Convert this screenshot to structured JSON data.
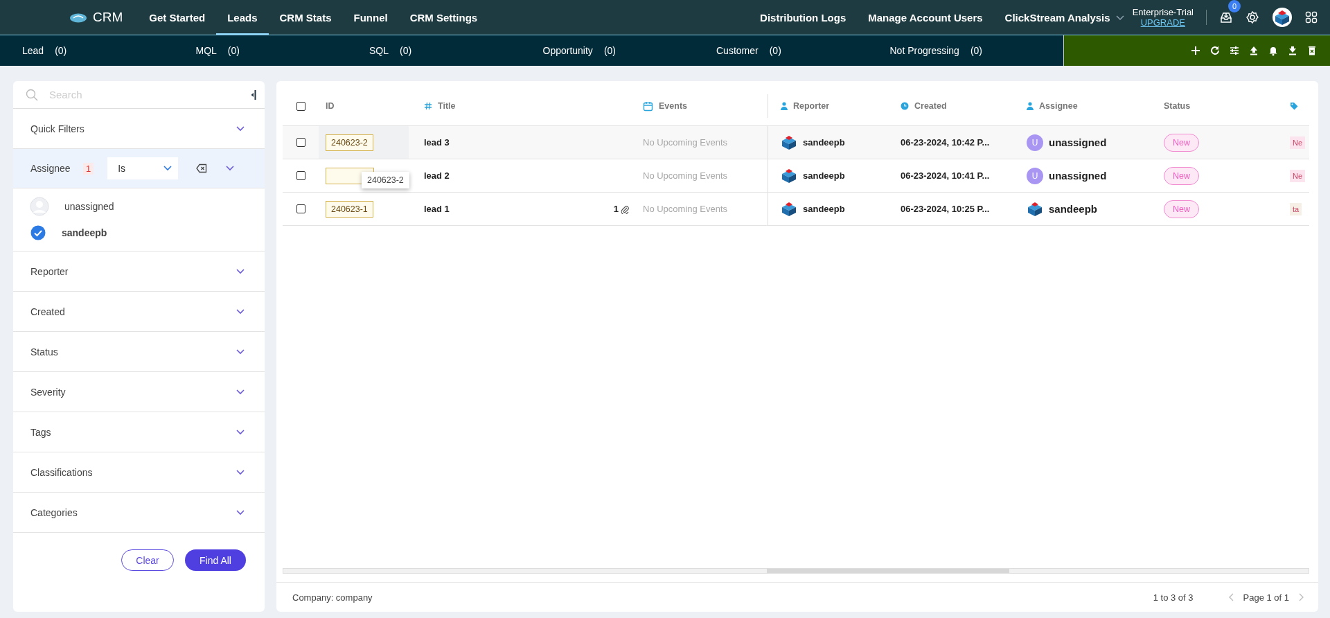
{
  "top_nav": {
    "logo": "CRM",
    "tabs": [
      {
        "label": "Get Started",
        "selected": false
      },
      {
        "label": "Leads",
        "selected": true
      },
      {
        "label": "CRM Stats",
        "selected": false
      },
      {
        "label": "Funnel",
        "selected": false
      },
      {
        "label": "CRM Settings",
        "selected": false
      }
    ],
    "links": [
      "Distribution Logs",
      "Manage Account Users"
    ],
    "project": "ClickStream Analysis",
    "plan": "Enterprise-Trial",
    "upgrade": "UPGRADE",
    "inbox_count": "0"
  },
  "stage_bar": [
    {
      "label": "Lead",
      "count": "(0)"
    },
    {
      "label": "MQL",
      "count": "(0)"
    },
    {
      "label": "SQL",
      "count": "(0)"
    },
    {
      "label": "Opportunity",
      "count": "(0)"
    },
    {
      "label": "Customer",
      "count": "(0)"
    },
    {
      "label": "Not Progressing",
      "count": "(0)"
    }
  ],
  "filters": {
    "search": {
      "placeholder": "Search"
    },
    "sections": [
      {
        "label": "Quick Filters",
        "expanded": false
      },
      {
        "label": "Assignee",
        "expanded": true,
        "count": "1",
        "operator": "Is",
        "options": [
          {
            "name": "unassigned",
            "checked": false
          },
          {
            "name": "sandeepb",
            "checked": true
          }
        ]
      },
      {
        "label": "Reporter",
        "expanded": false
      },
      {
        "label": "Created",
        "expanded": false
      },
      {
        "label": "Status",
        "expanded": false
      },
      {
        "label": "Severity",
        "expanded": false
      },
      {
        "label": "Tags",
        "expanded": false
      },
      {
        "label": "Classifications",
        "expanded": false
      },
      {
        "label": "Categories",
        "expanded": false
      }
    ],
    "buttons": [
      "Clear",
      "Find All"
    ]
  },
  "table": {
    "all_selected": false,
    "columns": [
      {
        "kind": "select"
      },
      {
        "kind": "id",
        "label": "ID"
      },
      {
        "kind": "title",
        "label": "Title"
      },
      {
        "kind": "events",
        "label": "Events"
      },
      {
        "kind": "reporter",
        "label": "Reporter"
      },
      {
        "kind": "created",
        "label": "Created"
      },
      {
        "kind": "assignee",
        "label": "Assignee"
      },
      {
        "kind": "status",
        "label": "Status"
      },
      {
        "kind": "tags"
      }
    ],
    "rows": [
      {
        "highlighted": true,
        "selected": false,
        "id": "240623-2",
        "title": "lead 3",
        "events": "No Upcoming Events",
        "reporter": "sandeepb",
        "created": "06-23-2024, 10:42 P...",
        "assignee": {
          "kind": "initial",
          "initial": "U",
          "name": "unassigned"
        },
        "status": "New",
        "tag": {
          "text": "Ne",
          "color": "#fbe4ee"
        }
      },
      {
        "highlighted": false,
        "selected": false,
        "tooltip": "240623-2",
        "title": "lead 2",
        "events": "No Upcoming Events",
        "reporter": "sandeepb",
        "created": "06-23-2024, 10:41 P...",
        "assignee": {
          "kind": "initial",
          "initial": "U",
          "name": "unassigned"
        },
        "status": "New",
        "tag": {
          "text": "Ne",
          "color": "#fbe4ee"
        }
      },
      {
        "highlighted": false,
        "selected": false,
        "id": "240623-1",
        "title": "lead 1",
        "attachments": "1",
        "events": "No Upcoming Events",
        "reporter": "sandeepb",
        "created": "06-23-2024, 10:25 P...",
        "assignee": {
          "kind": "logo",
          "name": "sandeepb"
        },
        "status": "New",
        "tag": {
          "text": "ta",
          "color": "#f5efe6"
        }
      }
    ]
  },
  "footer": {
    "company": "Company: company",
    "range": "1 to 3 of 3",
    "page": "Page 1 of 1"
  }
}
